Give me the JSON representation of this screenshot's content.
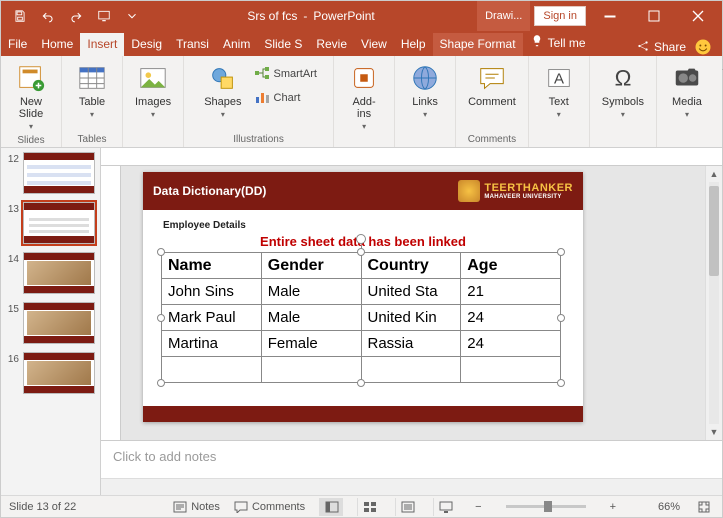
{
  "titlebar": {
    "doc_title": "Srs of fcs",
    "app_name": "PowerPoint",
    "context_tab": "Drawi...",
    "sign_in": "Sign in"
  },
  "tabs": {
    "file": "File",
    "home": "Home",
    "insert": "Insert",
    "design": "Desig",
    "transitions": "Transi",
    "animations": "Anim",
    "slideshow": "Slide S",
    "review": "Revie",
    "view": "View",
    "help": "Help",
    "shape_format": "Shape Format",
    "tell_me": "Tell me",
    "share": "Share"
  },
  "ribbon": {
    "slides": {
      "new_slide": "New\nSlide",
      "group": "Slides"
    },
    "tables": {
      "table": "Table",
      "group": "Tables"
    },
    "images": {
      "images": "Images"
    },
    "illustrations": {
      "shapes": "Shapes",
      "smartart": "SmartArt",
      "chart": "Chart",
      "group": "Illustrations"
    },
    "addins": {
      "addins": "Add-\nins"
    },
    "links": {
      "links": "Links"
    },
    "comments": {
      "comment": "Comment",
      "group": "Comments"
    },
    "text": {
      "text": "Text"
    },
    "symbols": {
      "symbols": "Symbols"
    },
    "media": {
      "media": "Media"
    }
  },
  "thumbs": {
    "nums": [
      "12",
      "13",
      "14",
      "15",
      "16"
    ],
    "selected_index": 1
  },
  "slide": {
    "header_title": "Data Dictionary(DD)",
    "brand_top": "TEERTHANKER",
    "brand_sub": "MAHAVEER UNIVERSITY",
    "brand_badge": "TMU",
    "employee_title": "Employee Details",
    "linked_note": "Entire sheet data has been linked",
    "table": {
      "headers": [
        "Name",
        "Gender",
        "Country",
        "Age"
      ],
      "rows": [
        [
          "John Sins",
          "Male",
          "United Sta",
          "21"
        ],
        [
          "Mark Paul",
          "Male",
          "United Kin",
          "24"
        ],
        [
          "Martina",
          "Female",
          "Rassia",
          "24"
        ]
      ]
    }
  },
  "notes": {
    "placeholder": "Click to add notes"
  },
  "status": {
    "slide_of": "Slide 13 of 22",
    "notes": "Notes",
    "comments": "Comments",
    "zoom": "66%",
    "zoom_minus": "−",
    "zoom_plus": "+"
  }
}
